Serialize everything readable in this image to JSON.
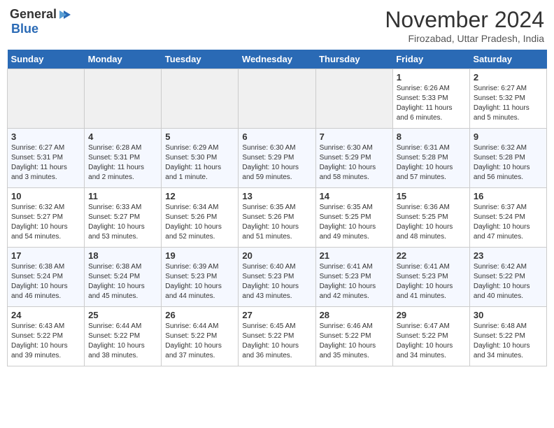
{
  "header": {
    "logo_general": "General",
    "logo_blue": "Blue",
    "month_year": "November 2024",
    "location": "Firozabad, Uttar Pradesh, India"
  },
  "weekdays": [
    "Sunday",
    "Monday",
    "Tuesday",
    "Wednesday",
    "Thursday",
    "Friday",
    "Saturday"
  ],
  "weeks": [
    [
      {
        "day": "",
        "empty": true
      },
      {
        "day": "",
        "empty": true
      },
      {
        "day": "",
        "empty": true
      },
      {
        "day": "",
        "empty": true
      },
      {
        "day": "",
        "empty": true
      },
      {
        "day": "1",
        "sunrise": "6:26 AM",
        "sunset": "5:33 PM",
        "daylight": "11 hours and 6 minutes."
      },
      {
        "day": "2",
        "sunrise": "6:27 AM",
        "sunset": "5:32 PM",
        "daylight": "11 hours and 5 minutes."
      }
    ],
    [
      {
        "day": "3",
        "sunrise": "6:27 AM",
        "sunset": "5:31 PM",
        "daylight": "11 hours and 3 minutes."
      },
      {
        "day": "4",
        "sunrise": "6:28 AM",
        "sunset": "5:31 PM",
        "daylight": "11 hours and 2 minutes."
      },
      {
        "day": "5",
        "sunrise": "6:29 AM",
        "sunset": "5:30 PM",
        "daylight": "11 hours and 1 minute."
      },
      {
        "day": "6",
        "sunrise": "6:30 AM",
        "sunset": "5:29 PM",
        "daylight": "10 hours and 59 minutes."
      },
      {
        "day": "7",
        "sunrise": "6:30 AM",
        "sunset": "5:29 PM",
        "daylight": "10 hours and 58 minutes."
      },
      {
        "day": "8",
        "sunrise": "6:31 AM",
        "sunset": "5:28 PM",
        "daylight": "10 hours and 57 minutes."
      },
      {
        "day": "9",
        "sunrise": "6:32 AM",
        "sunset": "5:28 PM",
        "daylight": "10 hours and 56 minutes."
      }
    ],
    [
      {
        "day": "10",
        "sunrise": "6:32 AM",
        "sunset": "5:27 PM",
        "daylight": "10 hours and 54 minutes."
      },
      {
        "day": "11",
        "sunrise": "6:33 AM",
        "sunset": "5:27 PM",
        "daylight": "10 hours and 53 minutes."
      },
      {
        "day": "12",
        "sunrise": "6:34 AM",
        "sunset": "5:26 PM",
        "daylight": "10 hours and 52 minutes."
      },
      {
        "day": "13",
        "sunrise": "6:35 AM",
        "sunset": "5:26 PM",
        "daylight": "10 hours and 51 minutes."
      },
      {
        "day": "14",
        "sunrise": "6:35 AM",
        "sunset": "5:25 PM",
        "daylight": "10 hours and 49 minutes."
      },
      {
        "day": "15",
        "sunrise": "6:36 AM",
        "sunset": "5:25 PM",
        "daylight": "10 hours and 48 minutes."
      },
      {
        "day": "16",
        "sunrise": "6:37 AM",
        "sunset": "5:24 PM",
        "daylight": "10 hours and 47 minutes."
      }
    ],
    [
      {
        "day": "17",
        "sunrise": "6:38 AM",
        "sunset": "5:24 PM",
        "daylight": "10 hours and 46 minutes."
      },
      {
        "day": "18",
        "sunrise": "6:38 AM",
        "sunset": "5:24 PM",
        "daylight": "10 hours and 45 minutes."
      },
      {
        "day": "19",
        "sunrise": "6:39 AM",
        "sunset": "5:23 PM",
        "daylight": "10 hours and 44 minutes."
      },
      {
        "day": "20",
        "sunrise": "6:40 AM",
        "sunset": "5:23 PM",
        "daylight": "10 hours and 43 minutes."
      },
      {
        "day": "21",
        "sunrise": "6:41 AM",
        "sunset": "5:23 PM",
        "daylight": "10 hours and 42 minutes."
      },
      {
        "day": "22",
        "sunrise": "6:41 AM",
        "sunset": "5:23 PM",
        "daylight": "10 hours and 41 minutes."
      },
      {
        "day": "23",
        "sunrise": "6:42 AM",
        "sunset": "5:22 PM",
        "daylight": "10 hours and 40 minutes."
      }
    ],
    [
      {
        "day": "24",
        "sunrise": "6:43 AM",
        "sunset": "5:22 PM",
        "daylight": "10 hours and 39 minutes."
      },
      {
        "day": "25",
        "sunrise": "6:44 AM",
        "sunset": "5:22 PM",
        "daylight": "10 hours and 38 minutes."
      },
      {
        "day": "26",
        "sunrise": "6:44 AM",
        "sunset": "5:22 PM",
        "daylight": "10 hours and 37 minutes."
      },
      {
        "day": "27",
        "sunrise": "6:45 AM",
        "sunset": "5:22 PM",
        "daylight": "10 hours and 36 minutes."
      },
      {
        "day": "28",
        "sunrise": "6:46 AM",
        "sunset": "5:22 PM",
        "daylight": "10 hours and 35 minutes."
      },
      {
        "day": "29",
        "sunrise": "6:47 AM",
        "sunset": "5:22 PM",
        "daylight": "10 hours and 34 minutes."
      },
      {
        "day": "30",
        "sunrise": "6:48 AM",
        "sunset": "5:22 PM",
        "daylight": "10 hours and 34 minutes."
      }
    ]
  ]
}
